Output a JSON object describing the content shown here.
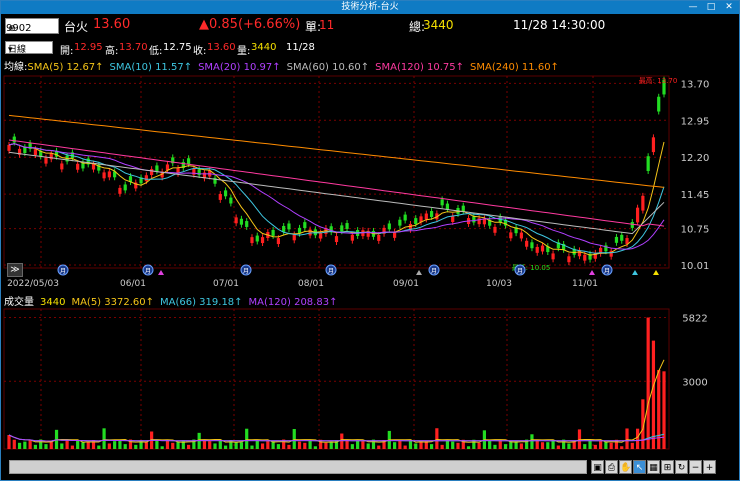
{
  "window": {
    "title": "技術分析-台火",
    "minimize": "—",
    "maximize": "□",
    "close": "✕"
  },
  "header": {
    "code": "9902",
    "name": "台火",
    "price": "13.60",
    "change": "▲0.85(+6.66%)",
    "single_label": "單:",
    "single_value": "11",
    "total_label": "總:",
    "total_value": "3440",
    "datetime": "11/28 14:30:00"
  },
  "ohlc": {
    "period": "日線",
    "open_label": "開:",
    "open": "12.95",
    "high_label": "高:",
    "high": "13.70",
    "low_label": "低:",
    "low": "12.75",
    "close_label": "收:",
    "close": "13.60",
    "vol_label": "量:",
    "vol": "3440",
    "date": "11/28"
  },
  "sma_legend": {
    "label": "均線:",
    "items": [
      {
        "text": "SMA(5) 12.67↑",
        "color": "#f5c518"
      },
      {
        "text": "SMA(10) 11.57↑",
        "color": "#3ec6e0"
      },
      {
        "text": "SMA(20) 10.97↑",
        "color": "#b040ff"
      },
      {
        "text": "SMA(60) 10.60↑",
        "color": "#bbbbbb"
      },
      {
        "text": "SMA(120) 10.75↑",
        "color": "#ff3aa0"
      },
      {
        "text": "SMA(240) 11.60↑",
        "color": "#ff8c00"
      }
    ]
  },
  "vol_legend": {
    "label": "成交量",
    "value": "3440",
    "items": [
      {
        "text": "MA(5) 3372.60↑",
        "color": "#f5c518"
      },
      {
        "text": "MA(66) 319.18↑",
        "color": "#3ec6e0"
      },
      {
        "text": "MA(120) 208.83↑",
        "color": "#b040ff"
      }
    ]
  },
  "colors": {
    "up": "#ff2020",
    "down": "#22dd22",
    "grid": "#7a0000",
    "axis": "#cccccc"
  },
  "price_axis": {
    "labels": [
      "13.70",
      "12.95",
      "12.20",
      "11.45",
      "10.75",
      "10.01"
    ],
    "max_marker": "最高: 13.70",
    "min_marker": "最低: 10.05"
  },
  "vol_axis": {
    "labels": [
      "5822",
      "3000"
    ]
  },
  "date_axis": {
    "labels": [
      "2022/05/03",
      "06/01",
      "07/01",
      "08/01",
      "09/01",
      "10/03",
      "11/01"
    ]
  },
  "markers": {
    "month_glyph": "月"
  },
  "toolbar": {
    "tools": [
      {
        "name": "save-tool",
        "glyph": "▣"
      },
      {
        "name": "print-tool",
        "glyph": "⎙"
      },
      {
        "name": "hand-tool",
        "glyph": "✋"
      },
      {
        "name": "pointer-tool",
        "glyph": "↖"
      },
      {
        "name": "grid-tool",
        "glyph": "▦"
      },
      {
        "name": "crosshair-tool",
        "glyph": "⊞"
      },
      {
        "name": "refresh-tool",
        "glyph": "↻"
      },
      {
        "name": "zoom-out-tool",
        "glyph": "−"
      },
      {
        "name": "zoom-in-tool",
        "glyph": "+"
      }
    ]
  },
  "expand_button": "≫"
}
